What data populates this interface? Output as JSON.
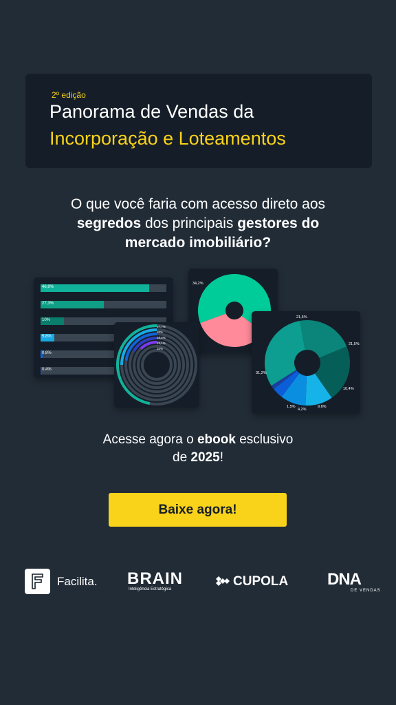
{
  "header": {
    "edition": "2º edição",
    "title_line1": "Panorama de Vendas da",
    "title_line2": "Incorporação e Loteamentos"
  },
  "question": {
    "line1": "O que você faria com acesso direto aos",
    "line2_bold_a": "segredos",
    "line2_mid": " dos principais ",
    "line2_bold_b": "gestores do",
    "line3_bold": "mercado imobiliário?"
  },
  "chart_data": [
    {
      "type": "bar",
      "orientation": "horizontal",
      "categories": [
        "46,9%",
        "27,3%",
        "10%",
        "5,8%",
        "0,8%",
        "0,4%"
      ],
      "values": [
        46.9,
        27.3,
        10,
        5.8,
        0.8,
        0.4
      ],
      "colors": [
        "#11b29a",
        "#0f9e86",
        "#0a7d6c",
        "#19a9e3",
        "#1264d4",
        "#1e4fa6"
      ]
    },
    {
      "type": "pie",
      "subtype": "radial-bar",
      "labels": [
        "37,7%",
        "20%",
        "18,2%",
        "13,1%",
        "10%"
      ],
      "values": [
        37.7,
        20,
        18.2,
        13.1,
        10
      ],
      "colors": [
        "#11b29a",
        "#19a9e3",
        "#1264d4",
        "#2d3fc0",
        "#7c3aed"
      ]
    },
    {
      "type": "pie",
      "subtype": "donut",
      "labels": [
        "34,2%",
        ""
      ],
      "values": [
        65.8,
        34.2
      ],
      "colors": [
        "#00cc9a",
        "#ff8a9a"
      ]
    },
    {
      "type": "pie",
      "subtype": "donut",
      "labels": [
        "21,5%",
        "21,5%",
        "10,4%",
        "9,6%",
        "4,2%",
        "1,5%",
        "31,2%"
      ],
      "values": [
        21.5,
        21.5,
        10.4,
        9.6,
        4.2,
        1.5,
        31.2
      ],
      "colors": [
        "#0b857a",
        "#065e58",
        "#16b3e8",
        "#0a8fe0",
        "#0b5ed7",
        "#1b3f9c",
        "#0d9d91"
      ]
    }
  ],
  "cta": {
    "line1_pre": "Acesse agora o ",
    "line1_bold": "ebook",
    "line1_post": " esclusivo",
    "line2_pre": "de ",
    "line2_bold": "2025",
    "line2_post": "!",
    "button": "Baixe agora!"
  },
  "logos": {
    "facilita": "Facilita.",
    "brain": "BRAIN",
    "brain_sub": "Inteligência Estratégica",
    "cupola": "CUPOLA",
    "dna": "DNA",
    "dna_sub": "DE VENDAS"
  },
  "colors": {
    "background": "#222c37",
    "panel": "#151e28",
    "accent": "#f9d21a"
  }
}
